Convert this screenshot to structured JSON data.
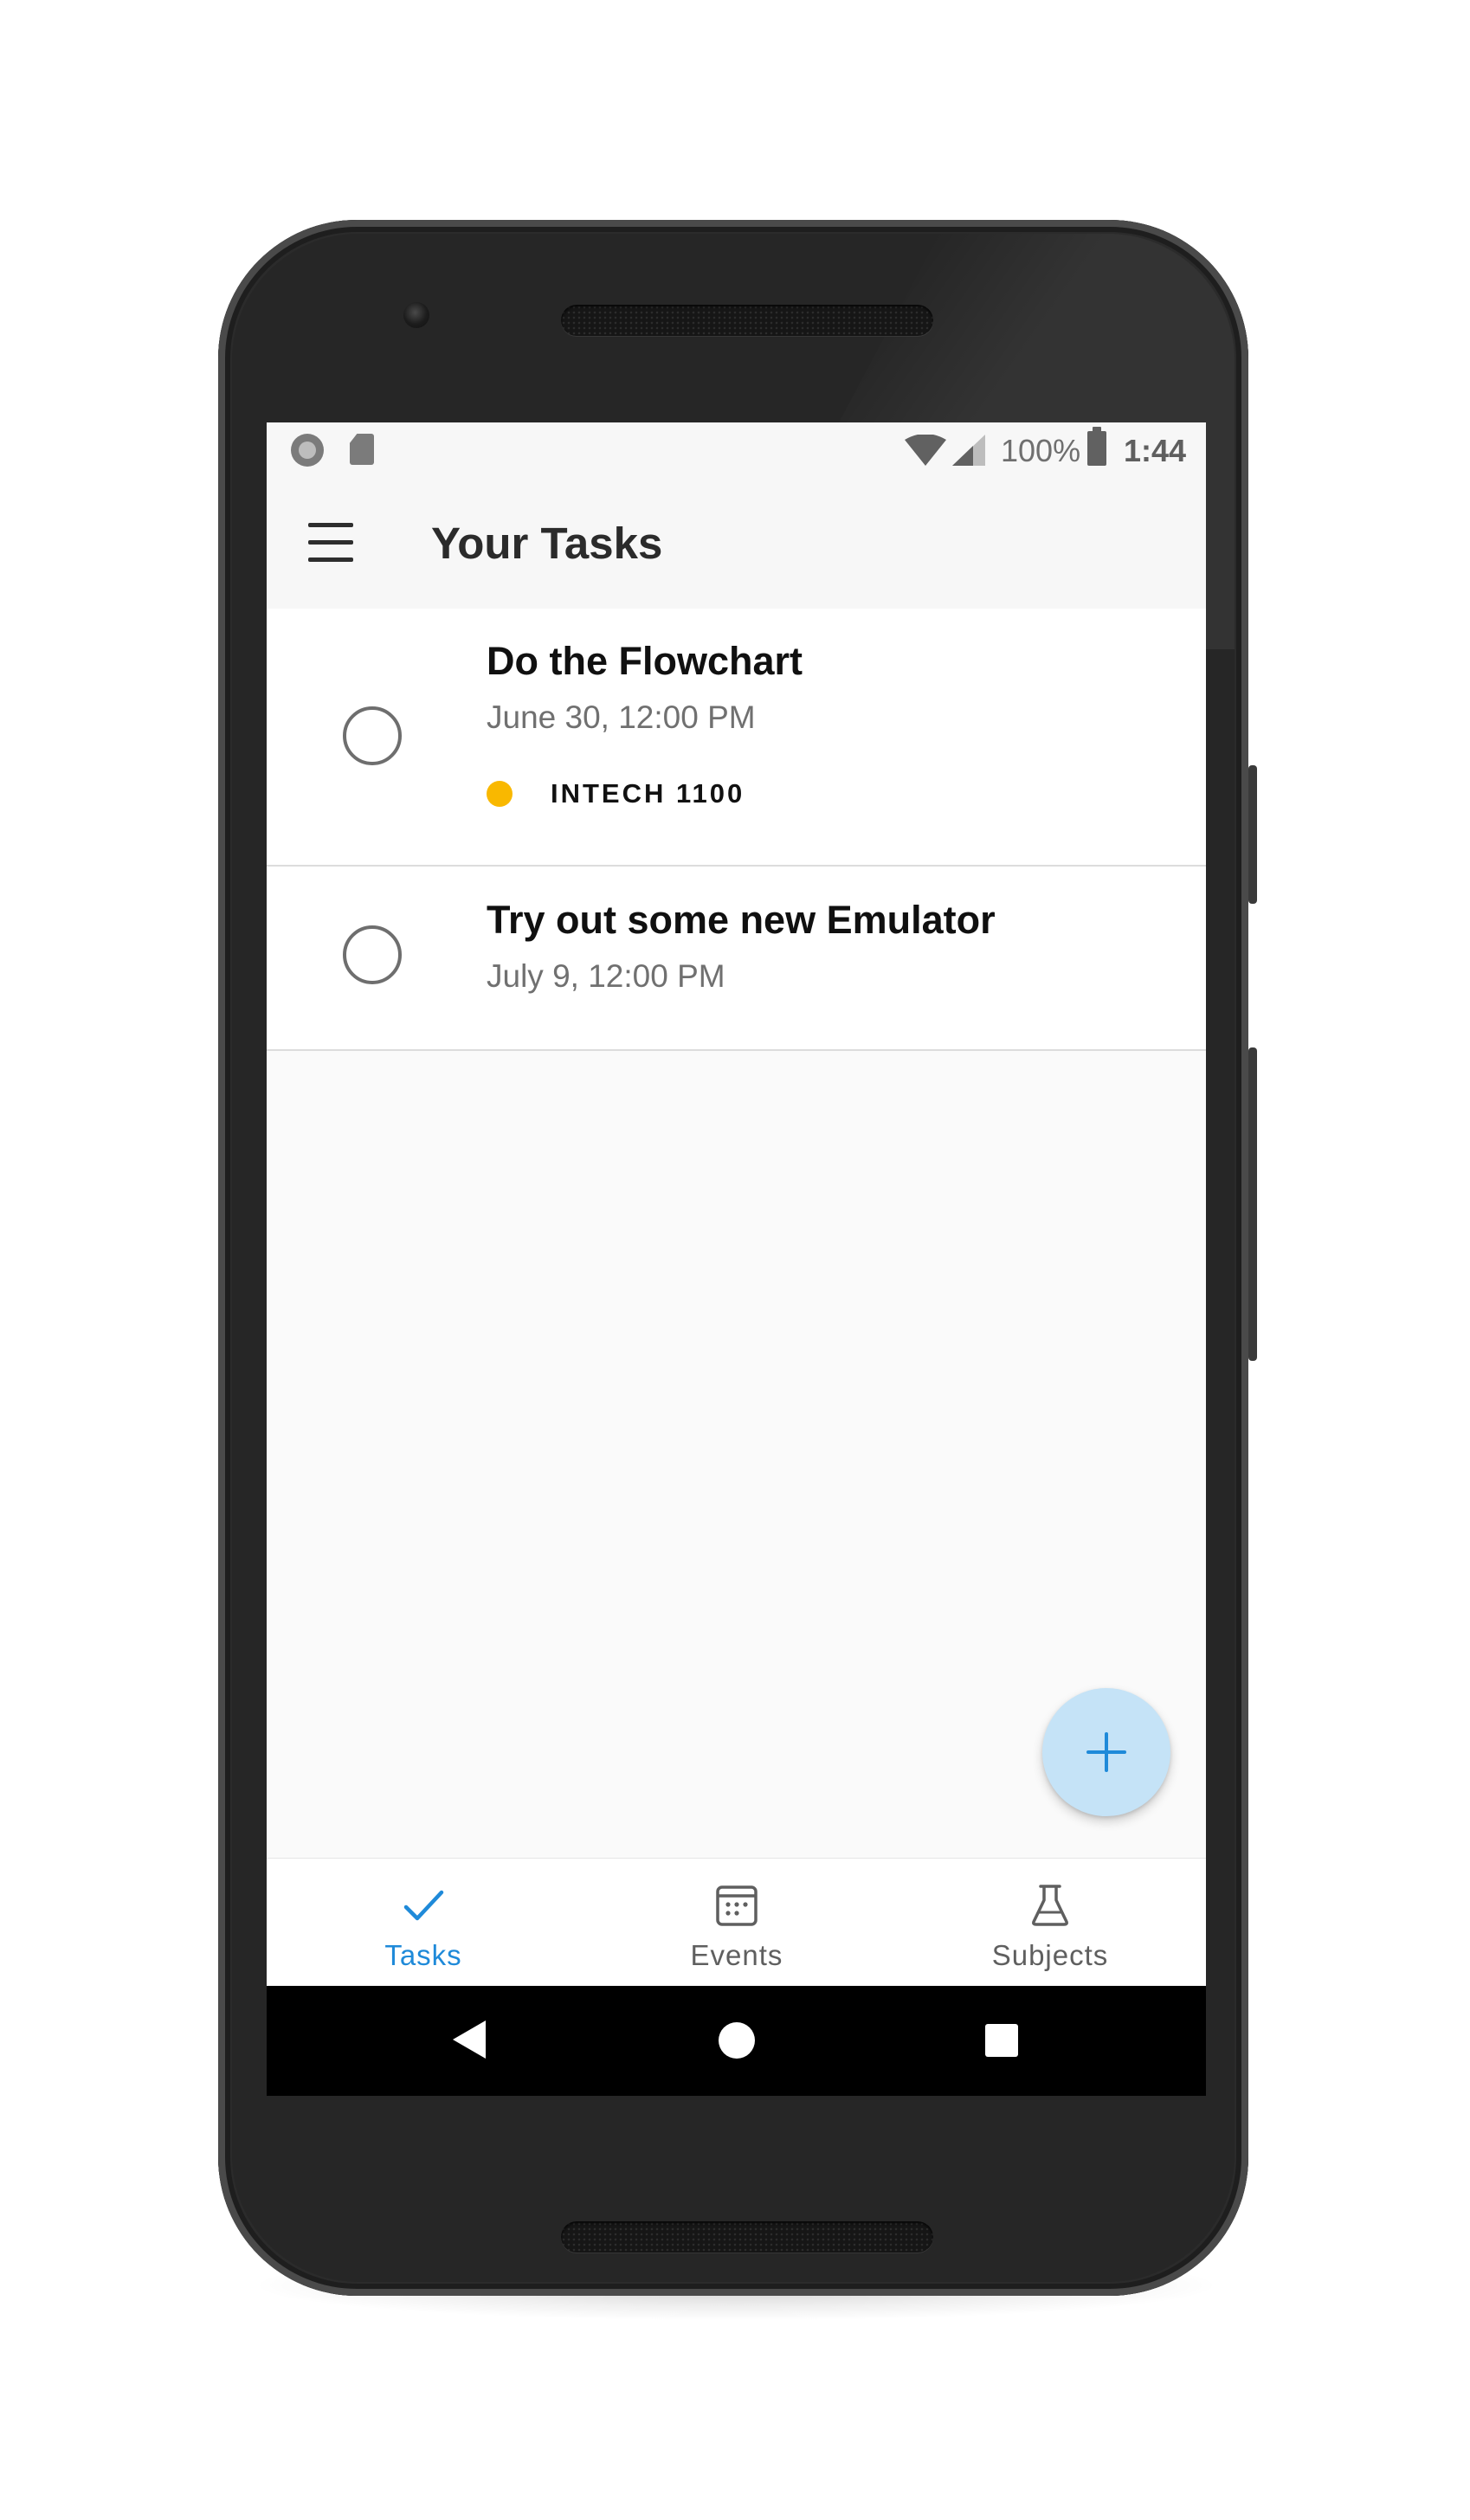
{
  "status_bar": {
    "battery_percent": "100%",
    "time": "1:44"
  },
  "app_bar": {
    "title": "Your Tasks"
  },
  "tasks": [
    {
      "title": "Do the Flowchart",
      "due": "June 30, 12:00 PM",
      "subject": "INTECH 1100",
      "subject_color": "#F9B800",
      "completed": false
    },
    {
      "title": "Try out some new Emulator",
      "due": "July 9, 12:00 PM",
      "completed": false
    }
  ],
  "fab": {
    "icon": "plus-icon"
  },
  "bottom_nav": {
    "tabs": [
      {
        "label": "Tasks",
        "icon": "check-icon",
        "active": true
      },
      {
        "label": "Events",
        "icon": "calendar-icon",
        "active": false
      },
      {
        "label": "Subjects",
        "icon": "flask-icon",
        "active": false
      }
    ],
    "active_color": "#1F8AD9",
    "inactive_color": "#5F5F5F"
  },
  "colors": {
    "accent": "#1F8AD9",
    "fab_background": "#C5E3F7",
    "subject_dot": "#F9B800"
  }
}
